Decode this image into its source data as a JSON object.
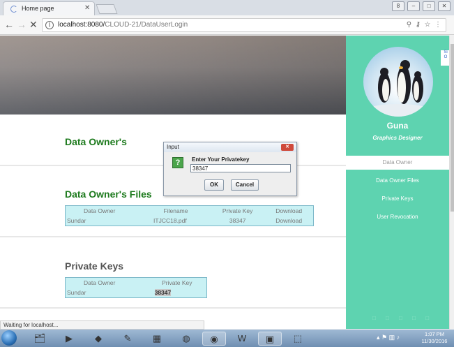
{
  "browser": {
    "tab_title": "Home page",
    "address_host": "localhost:8080/",
    "address_path": "CLOUD-21/DataUserLogin"
  },
  "sections": {
    "data_owner": "Data Owner's",
    "data_owner_files": "Data Owner's Files",
    "private_keys": "Private Keys"
  },
  "files_table": {
    "headers": [
      "Data Owner",
      "Filename",
      "Private Key",
      "Download"
    ],
    "rows": [
      [
        "Sundar",
        "ITJCC18.pdf",
        "38347",
        "Download"
      ]
    ]
  },
  "keys_table": {
    "headers": [
      "Data Owner",
      "Private Key"
    ],
    "rows": [
      [
        "Sundar",
        "38347"
      ]
    ]
  },
  "sidebar": {
    "name": "Guna",
    "role": "Graphics Designer",
    "items": [
      "Data Owner",
      "Data Owner Files",
      "Private Keys",
      "User Revocation"
    ],
    "dots": "□ □ □ □ □",
    "signout": "Si\nO"
  },
  "dialog": {
    "title": "Input",
    "prompt": "Enter Your Privatekey",
    "value": "38347",
    "ok": "OK",
    "cancel": "Cancel",
    "icon": "?"
  },
  "status_bar": "Waiting for localhost...",
  "taskbar": {
    "time": "1:07 PM",
    "date": "11/30/2016"
  }
}
